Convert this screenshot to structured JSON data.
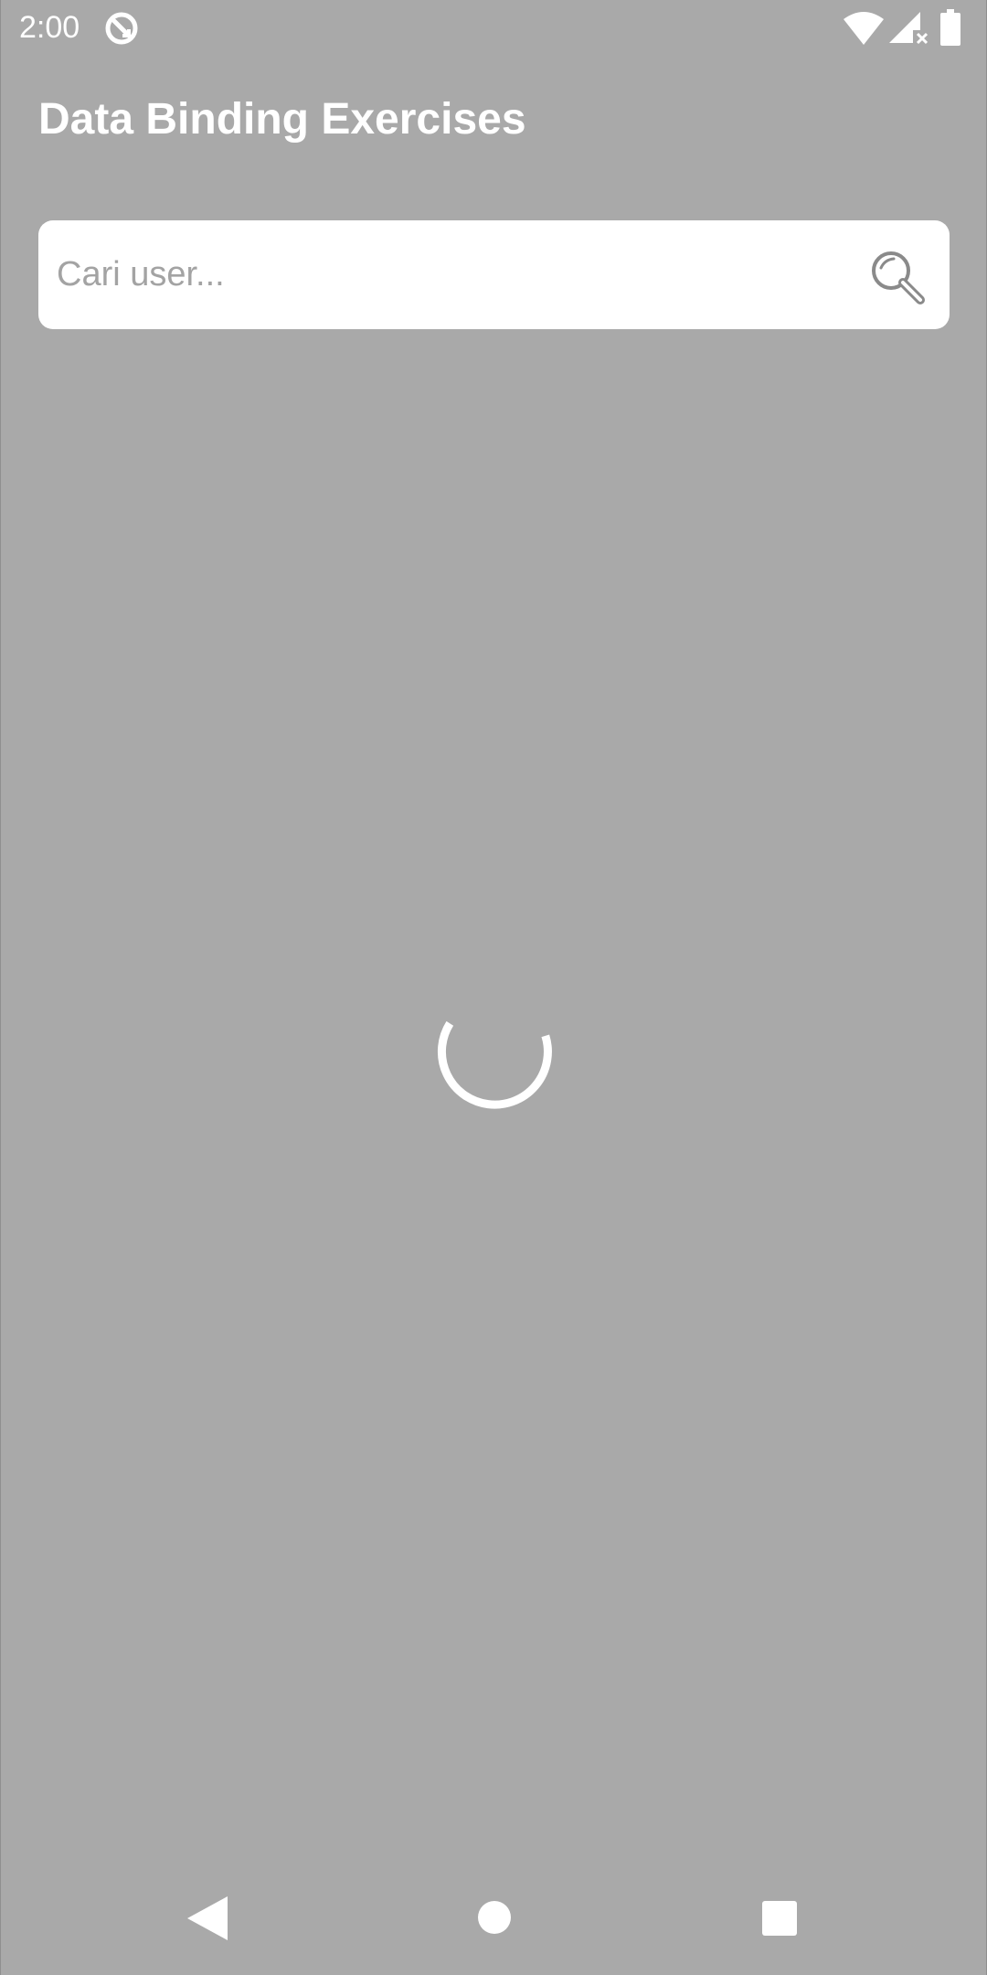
{
  "status_bar": {
    "time": "2:00",
    "icons": [
      "app-notification-icon",
      "wifi-icon",
      "signal-icon",
      "battery-icon"
    ]
  },
  "header": {
    "title": "Data Binding Exercises"
  },
  "search": {
    "placeholder": "Cari user...",
    "value": "",
    "icon": "search-icon"
  },
  "content": {
    "state": "loading",
    "indicator": "loading-spinner"
  },
  "navigation_bar": {
    "buttons": [
      "back",
      "home",
      "recents"
    ]
  },
  "colors": {
    "scrim_background": "#a9a9a9",
    "foreground": "#ffffff",
    "search_background": "#ffffff",
    "placeholder_text": "#a3a3a3",
    "search_icon": "#8a8a8a"
  }
}
